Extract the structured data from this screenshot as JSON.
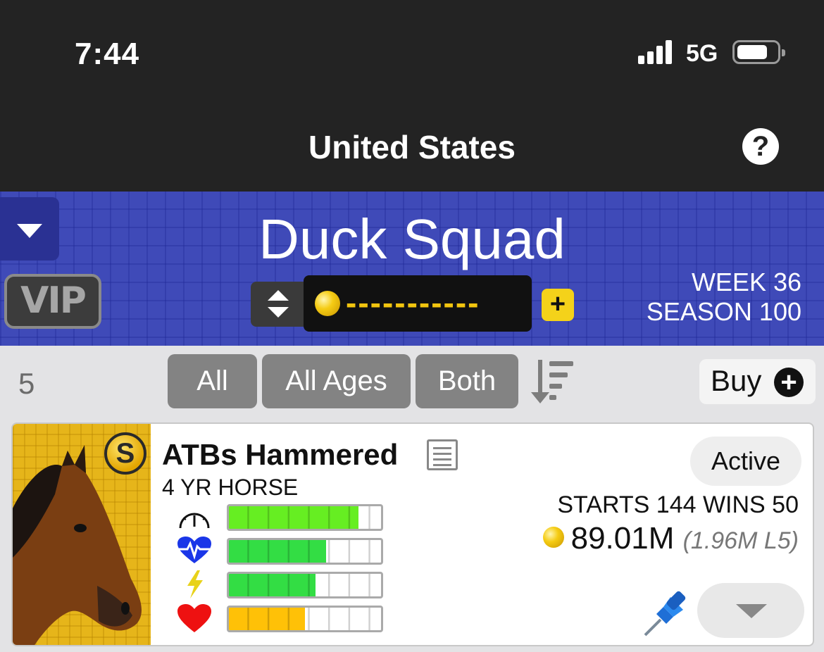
{
  "status_bar": {
    "time": "7:44",
    "network": "5G",
    "battery_level": 0.8
  },
  "nav": {
    "title": "United States",
    "help_symbol": "?"
  },
  "stable": {
    "name": "Duck Squad",
    "vip_label": "VIP",
    "balance_text": "-----------",
    "add_symbol": "+",
    "week_label": "WEEK  36",
    "season_label": "SEASON  100",
    "colors": {
      "background": "#3f4ab8",
      "coin": "#f5cc14"
    }
  },
  "filters": {
    "count": "5",
    "type_label": "All",
    "ages_label": "All Ages",
    "gender_label": "Both",
    "buy_label": "Buy",
    "buy_symbol": "+"
  },
  "horses": [
    {
      "name": "ATBs Hammered",
      "grade_badge": "S",
      "age_label": "4 YR HORSE",
      "status": "Active",
      "record": "STARTS 144 WINS 50",
      "earnings": "89.01M",
      "earnings_l5": "(1.96M L5)",
      "stats": [
        {
          "icon": "speedometer-icon",
          "level": 0.85,
          "color": "#66ee22"
        },
        {
          "icon": "heartbeat-icon",
          "level": 0.64,
          "color": "#33dd44"
        },
        {
          "icon": "lightning-icon",
          "level": 0.57,
          "color": "#33dd44"
        },
        {
          "icon": "heart-icon",
          "level": 0.5,
          "color": "#ffc107"
        }
      ]
    }
  ]
}
